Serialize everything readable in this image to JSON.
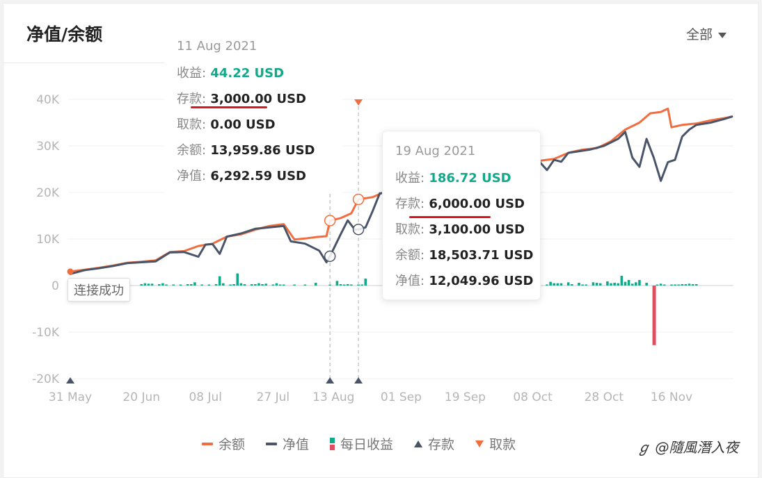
{
  "header": {
    "title": "净值/余额",
    "range_select": "全部"
  },
  "tooltips": [
    {
      "date": "11 Aug 2021",
      "rows": [
        {
          "label": "收益:",
          "value": "44.22 USD",
          "highlight": true
        },
        {
          "label": "存款:",
          "value": "3,000.00 USD"
        },
        {
          "label": "取款:",
          "value": "0.00 USD"
        },
        {
          "label": "余额:",
          "value": "13,959.86 USD"
        },
        {
          "label": "净值:",
          "value": "6,292.59 USD"
        }
      ]
    },
    {
      "date": "19 Aug 2021",
      "rows": [
        {
          "label": "收益:",
          "value": "186.72 USD",
          "highlight": true
        },
        {
          "label": "存款:",
          "value": "6,000.00 USD"
        },
        {
          "label": "取款:",
          "value": "3,100.00 USD"
        },
        {
          "label": "余额:",
          "value": "18,503.71 USD"
        },
        {
          "label": "净值:",
          "value": "12,049.96 USD"
        }
      ]
    }
  ],
  "status_toast": "连接成功",
  "legend": [
    {
      "name": "余额",
      "type": "line",
      "color": "#f26d3d"
    },
    {
      "name": "净值",
      "type": "line",
      "color": "#4a5468"
    },
    {
      "name": "每日收益",
      "type": "bar",
      "colors": [
        "#11a98a",
        "#e04e5f"
      ]
    },
    {
      "name": "存款",
      "type": "triangle-up",
      "color": "#4a5468"
    },
    {
      "name": "取款",
      "type": "triangle-down",
      "color": "#f26d3d"
    }
  ],
  "watermark": "@隨風潛入夜",
  "colors": {
    "balance": "#f26d3d",
    "equity": "#4a5468",
    "profit": "#11a98a",
    "loss": "#e04e5f",
    "grid": "#f0f0f0"
  },
  "chart_data": {
    "type": "line",
    "title": "净值/余额",
    "xlabel": "",
    "ylabel": "",
    "x_unit": "days since 31 May 2021",
    "ylim": [
      -20000,
      40000
    ],
    "xlim": [
      0,
      186
    ],
    "y_ticks": [
      {
        "value": 40000,
        "label": "40K"
      },
      {
        "value": 30000,
        "label": "30K"
      },
      {
        "value": 20000,
        "label": "20K"
      },
      {
        "value": 10000,
        "label": "10K"
      },
      {
        "value": 0,
        "label": "0"
      },
      {
        "value": -10000,
        "label": "-10K"
      },
      {
        "value": -20000,
        "label": "-20K"
      }
    ],
    "x_ticks": [
      {
        "day": 0,
        "label": "31 May"
      },
      {
        "day": 20,
        "label": "20 Jun"
      },
      {
        "day": 38,
        "label": "08 Jul"
      },
      {
        "day": 57,
        "label": "27 Jul"
      },
      {
        "day": 74,
        "label": "13 Aug"
      },
      {
        "day": 93,
        "label": "01 Sep"
      },
      {
        "day": 111,
        "label": "19 Sep"
      },
      {
        "day": 130,
        "label": "08 Oct"
      },
      {
        "day": 150,
        "label": "28 Oct"
      },
      {
        "day": 169,
        "label": "16 Nov"
      }
    ],
    "grid": true,
    "legend_position": "bottom",
    "series": [
      {
        "name": "余额",
        "points": [
          [
            0,
            3000
          ],
          [
            4,
            3400
          ],
          [
            8,
            3800
          ],
          [
            12,
            4300
          ],
          [
            16,
            4900
          ],
          [
            20,
            5100
          ],
          [
            24,
            5400
          ],
          [
            28,
            7200
          ],
          [
            32,
            7400
          ],
          [
            36,
            8500
          ],
          [
            40,
            9000
          ],
          [
            44,
            10500
          ],
          [
            48,
            11000
          ],
          [
            52,
            12000
          ],
          [
            56,
            12800
          ],
          [
            60,
            13200
          ],
          [
            63,
            9900
          ],
          [
            66,
            10100
          ],
          [
            69,
            10400
          ],
          [
            72,
            10600
          ],
          [
            73,
            13959
          ],
          [
            76,
            14500
          ],
          [
            79,
            15500
          ],
          [
            81,
            18503
          ],
          [
            85,
            19000
          ],
          [
            88,
            20000
          ],
          [
            92,
            20500
          ],
          [
            96,
            21000
          ],
          [
            100,
            21500
          ],
          [
            104,
            22500
          ],
          [
            108,
            23000
          ],
          [
            112,
            23800
          ],
          [
            116,
            24300
          ],
          [
            120,
            25000
          ],
          [
            124,
            25500
          ],
          [
            128,
            25500
          ],
          [
            132,
            26800
          ],
          [
            136,
            27200
          ],
          [
            140,
            28500
          ],
          [
            144,
            29200
          ],
          [
            148,
            29500
          ],
          [
            152,
            31000
          ],
          [
            156,
            33500
          ],
          [
            160,
            35000
          ],
          [
            163,
            37000
          ],
          [
            166,
            37300
          ],
          [
            168,
            38000
          ],
          [
            169,
            34000
          ],
          [
            172,
            34500
          ],
          [
            176,
            34800
          ],
          [
            180,
            35500
          ],
          [
            184,
            36000
          ],
          [
            186,
            36300
          ]
        ]
      },
      {
        "name": "净值",
        "points": [
          [
            0,
            2500
          ],
          [
            4,
            3300
          ],
          [
            8,
            3700
          ],
          [
            12,
            4200
          ],
          [
            16,
            4800
          ],
          [
            20,
            5000
          ],
          [
            24,
            5200
          ],
          [
            28,
            7100
          ],
          [
            32,
            7200
          ],
          [
            36,
            6200
          ],
          [
            38,
            8800
          ],
          [
            40,
            8900
          ],
          [
            42,
            6800
          ],
          [
            44,
            10500
          ],
          [
            48,
            11200
          ],
          [
            52,
            12200
          ],
          [
            56,
            12500
          ],
          [
            60,
            12800
          ],
          [
            62,
            9500
          ],
          [
            66,
            9000
          ],
          [
            70,
            7500
          ],
          [
            72,
            5000
          ],
          [
            73,
            6292
          ],
          [
            76,
            11000
          ],
          [
            78,
            14000
          ],
          [
            80,
            12000
          ],
          [
            81,
            12050
          ],
          [
            83,
            12500
          ],
          [
            85,
            16000
          ],
          [
            87,
            19800
          ],
          [
            90,
            20000
          ],
          [
            94,
            20500
          ],
          [
            98,
            21000
          ],
          [
            102,
            21500
          ],
          [
            106,
            22000
          ],
          [
            110,
            22800
          ],
          [
            114,
            23500
          ],
          [
            118,
            24200
          ],
          [
            122,
            25000
          ],
          [
            125,
            25200
          ],
          [
            128,
            24500
          ],
          [
            132,
            26500
          ],
          [
            134,
            24800
          ],
          [
            136,
            27000
          ],
          [
            138,
            26600
          ],
          [
            140,
            28500
          ],
          [
            146,
            29200
          ],
          [
            150,
            30000
          ],
          [
            154,
            31500
          ],
          [
            156,
            33000
          ],
          [
            158,
            27500
          ],
          [
            160,
            25500
          ],
          [
            162,
            31500
          ],
          [
            164,
            27500
          ],
          [
            166,
            22500
          ],
          [
            168,
            26500
          ],
          [
            170,
            27000
          ],
          [
            172,
            32000
          ],
          [
            174,
            33500
          ],
          [
            176,
            34500
          ],
          [
            180,
            35000
          ],
          [
            184,
            35800
          ],
          [
            186,
            36300
          ]
        ]
      }
    ],
    "daily_profit": [
      [
        20,
        300
      ],
      [
        21,
        500
      ],
      [
        22,
        400
      ],
      [
        23,
        400
      ],
      [
        25,
        300
      ],
      [
        26,
        500
      ],
      [
        27,
        200
      ],
      [
        29,
        200
      ],
      [
        31,
        100
      ],
      [
        33,
        300
      ],
      [
        34,
        300
      ],
      [
        35,
        700
      ],
      [
        37,
        100
      ],
      [
        39,
        100
      ],
      [
        41,
        300
      ],
      [
        42,
        2000
      ],
      [
        43,
        500
      ],
      [
        45,
        200
      ],
      [
        46,
        300
      ],
      [
        47,
        2600
      ],
      [
        48,
        500
      ],
      [
        49,
        300
      ],
      [
        51,
        300
      ],
      [
        52,
        300
      ],
      [
        53,
        500
      ],
      [
        54,
        300
      ],
      [
        55,
        400
      ],
      [
        57,
        200
      ],
      [
        58,
        500
      ],
      [
        59,
        200
      ],
      [
        60,
        100
      ],
      [
        63,
        150
      ],
      [
        66,
        100
      ],
      [
        69,
        600
      ],
      [
        73,
        44
      ],
      [
        75,
        1000
      ],
      [
        76,
        300
      ],
      [
        77,
        200
      ],
      [
        78,
        300
      ],
      [
        79,
        100
      ],
      [
        81,
        187
      ],
      [
        82,
        100
      ],
      [
        83,
        1500
      ],
      [
        134,
        100
      ],
      [
        135,
        800
      ],
      [
        136,
        500
      ],
      [
        137,
        500
      ],
      [
        138,
        500
      ],
      [
        140,
        700
      ],
      [
        141,
        300
      ],
      [
        143,
        600
      ],
      [
        144,
        100
      ],
      [
        145,
        100
      ],
      [
        147,
        700
      ],
      [
        148,
        600
      ],
      [
        149,
        500
      ],
      [
        151,
        900
      ],
      [
        152,
        500
      ],
      [
        153,
        600
      ],
      [
        154,
        500
      ],
      [
        155,
        2100
      ],
      [
        156,
        800
      ],
      [
        157,
        1200
      ],
      [
        158,
        400
      ],
      [
        159,
        700
      ],
      [
        160,
        1200
      ],
      [
        162,
        600
      ],
      [
        164,
        -12800
      ],
      [
        165,
        200
      ],
      [
        166,
        400
      ],
      [
        167,
        200
      ],
      [
        169,
        200
      ],
      [
        170,
        100
      ],
      [
        171,
        100
      ],
      [
        172,
        300
      ],
      [
        173,
        300
      ],
      [
        174,
        400
      ],
      [
        175,
        300
      ],
      [
        176,
        300
      ]
    ],
    "deposits_days": [
      0,
      73,
      81
    ],
    "withdrawals_days": [
      81
    ],
    "highlighted_days": [
      73,
      81
    ]
  }
}
